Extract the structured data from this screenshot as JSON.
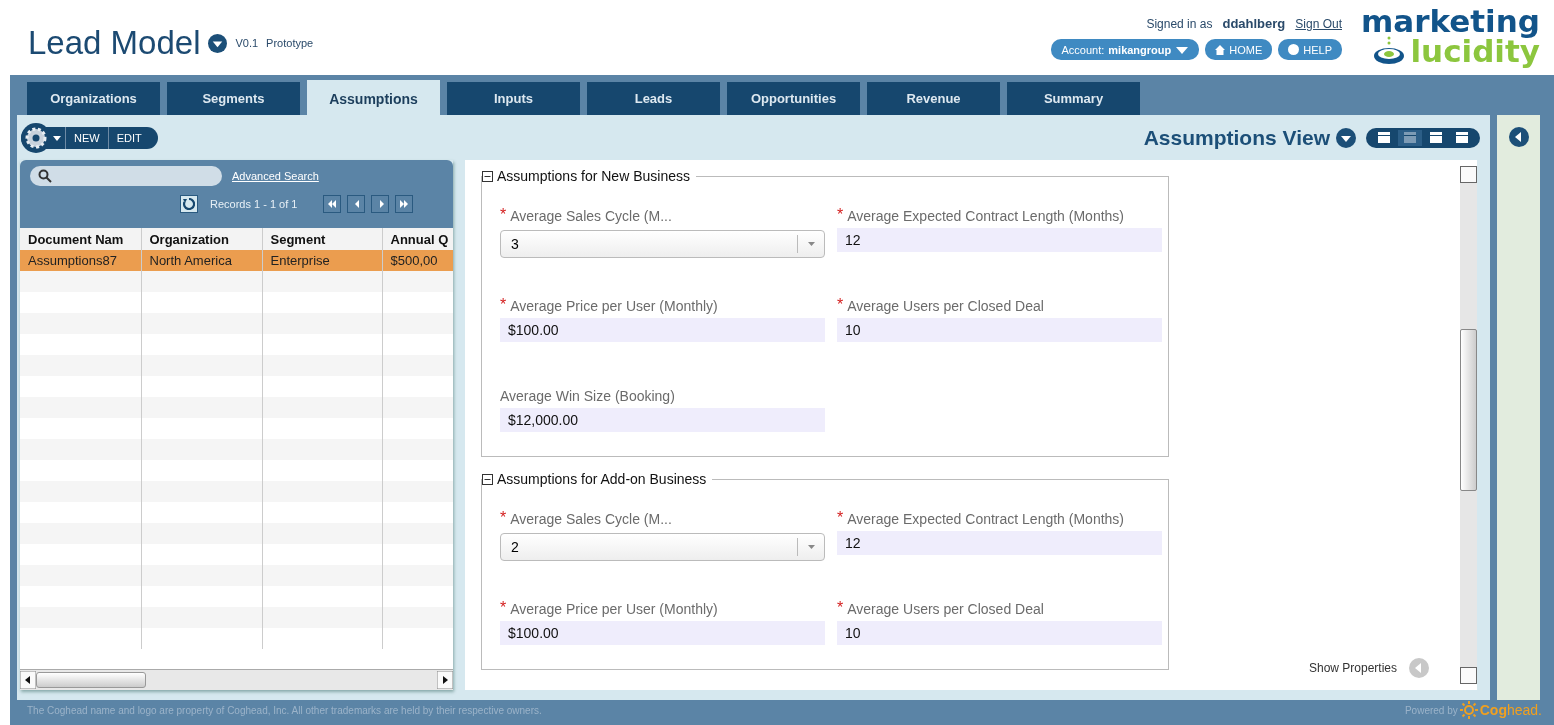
{
  "app": {
    "title": "Lead Model",
    "version": "V0.1",
    "stage": "Prototype"
  },
  "user": {
    "signed_in_label": "Signed in as",
    "username": "ddahlberg",
    "sign_out": "Sign Out",
    "account_label": "Account:",
    "account": "mikangroup",
    "home": "HOME",
    "help": "HELP"
  },
  "logo": {
    "line_1": "marketing",
    "line_2": "lucidity"
  },
  "tabs": [
    {
      "label": "Organizations",
      "selected": false
    },
    {
      "label": "Segments",
      "selected": false
    },
    {
      "label": "Assumptions",
      "selected": true
    },
    {
      "label": "Inputs",
      "selected": false
    },
    {
      "label": "Leads",
      "selected": false
    },
    {
      "label": "Opportunities",
      "selected": false
    },
    {
      "label": "Revenue",
      "selected": false
    },
    {
      "label": "Summary",
      "selected": false
    }
  ],
  "toolbar": {
    "buttons": [
      "NEW",
      "EDIT"
    ],
    "view_title": "Assumptions View",
    "view_modes": [
      {
        "selected": false
      },
      {
        "selected": true
      },
      {
        "selected": false
      },
      {
        "selected": false
      }
    ]
  },
  "list": {
    "advanced_search": "Advanced Search",
    "records": "Records 1 - 1 of 1",
    "columns": [
      "Document Nam",
      "Organization",
      "Segment",
      "Annual Q"
    ],
    "rows": [
      {
        "cells": [
          "Assumptions87",
          "North America",
          "Enterprise",
          "$500,00"
        ],
        "selected": true
      }
    ]
  },
  "sections": [
    {
      "title": "Assumptions for New Business",
      "rows": [
        [
          {
            "label": "Average Sales Cycle (M...",
            "required_mark": "*",
            "kind": "select",
            "value": "3"
          },
          {
            "label": "Average Expected Contract Length (Months)",
            "required_mark": "*",
            "kind": "text",
            "value": "12"
          }
        ],
        [
          {
            "label": "Average Price per User (Monthly)",
            "required_mark": "*",
            "kind": "text",
            "value": "$100.00"
          },
          {
            "label": "Average Users per Closed Deal",
            "required_mark": "*",
            "kind": "text",
            "value": "10"
          }
        ],
        [
          {
            "label": "Average Win Size (Booking)",
            "kind": "text",
            "value": "$12,000.00"
          }
        ]
      ]
    },
    {
      "title": "Assumptions for Add-on Business",
      "rows": [
        [
          {
            "label": "Average Sales Cycle (M...",
            "required_mark": "*",
            "kind": "select",
            "value": "2"
          },
          {
            "label": "Average Expected Contract Length (Months)",
            "required_mark": "*",
            "kind": "text",
            "value": "12"
          }
        ],
        [
          {
            "label": "Average Price per User (Monthly)",
            "required_mark": "*",
            "kind": "text",
            "value": "$100.00"
          },
          {
            "label": "Average Users per Closed Deal",
            "required_mark": "*",
            "kind": "text",
            "value": "10"
          }
        ]
      ]
    }
  ],
  "show_properties": "Show Properties",
  "footer": {
    "notice": "The Coghead name and logo are property of Coghead, Inc. All other trademarks are held by their respective owners.",
    "powered_by": "Powered by",
    "brand_1": "Cog",
    "brand_2": "head."
  }
}
